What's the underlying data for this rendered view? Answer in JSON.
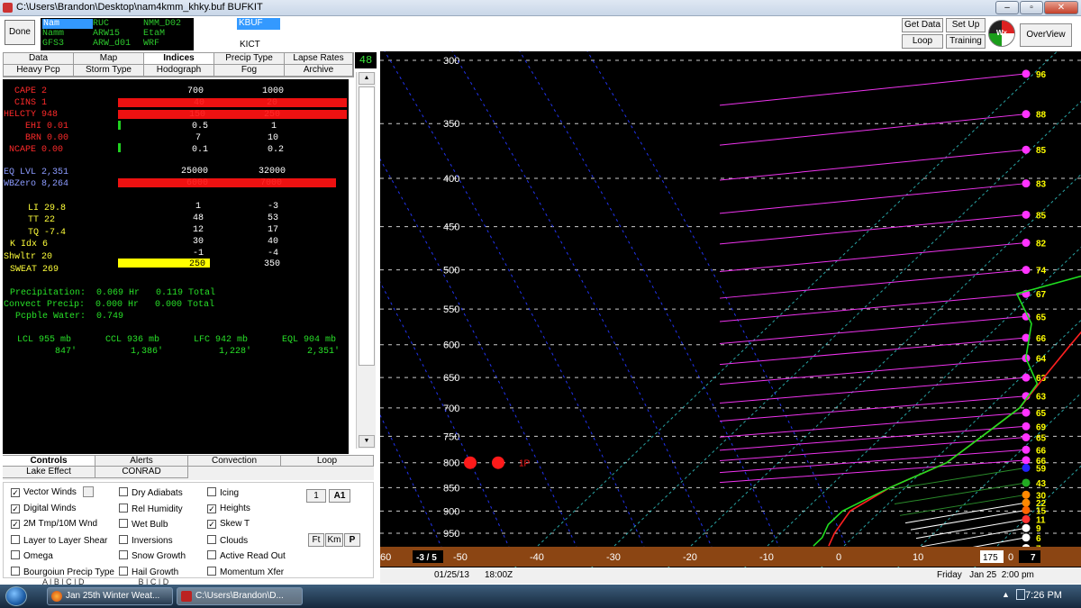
{
  "window": {
    "title": "C:\\Users\\Brandon\\Desktop\\nam4kmm_khky.buf BUFKIT",
    "min_label": "–",
    "max_label": "▫",
    "close_label": "✕"
  },
  "header": {
    "done_label": "Done",
    "models": [
      [
        "Nam",
        "RUC",
        "NMM_D02"
      ],
      [
        "Namm",
        "ARW15",
        "EtaM"
      ],
      [
        "GFS3",
        "ARW_d01",
        "WRF"
      ]
    ],
    "selected_station": "KBUF",
    "station_label": "KICT",
    "get_data": "Get Data",
    "setup": "Set Up",
    "loop": "Loop",
    "training": "Training",
    "overview": "OverView",
    "logo_text": "Wx"
  },
  "tabs_row1": [
    "Data",
    "Map",
    "Indices",
    "Precip Type",
    "Lapse Rates"
  ],
  "tabs_row2": [
    "Heavy Pcp",
    "Storm Type",
    "Hodograph",
    "Fog",
    "Archive"
  ],
  "hour_display": "48",
  "indices": {
    "cape": "CAPE 2",
    "cape_c1": "700",
    "cape_c2": "1000",
    "cins": "CINS 1",
    "cins_c1": "40",
    "cins_c2": "20",
    "helcty": "HELCTY 948",
    "helcty_c1": "150",
    "helcty_c2": "250",
    "ehi": "EHI 0.01",
    "ehi_c1": "0.5",
    "ehi_c2": "1",
    "brn": "BRN 0.00",
    "brn_c1": "7",
    "brn_c2": "10",
    "ncape": "NCAPE 0.00",
    "ncape_c1": "0.1",
    "ncape_c2": "0.2",
    "eqlvl": "EQ LVL 2,351",
    "eqlvl_c1": "25000",
    "eqlvl_c2": "32000",
    "wbzero": "WBZero 8,264",
    "wbzero_c1": "6000",
    "wbzero_c2": "7000",
    "li": "LI 29.8",
    "li_c1": "1",
    "li_c2": "-3",
    "tt": "TT 22",
    "tt_c1": "48",
    "tt_c2": "53",
    "tq": "TQ -7.4",
    "tq_c1": "12",
    "tq_c2": "17",
    "kidx": "K Idx 6",
    "kidx_c1": "30",
    "kidx_c2": "40",
    "shwltr": "Shwltr 20",
    "shwltr_c1": "-1",
    "shwltr_c2": "-4",
    "sweat": "SWEAT 269",
    "sweat_c1": "250",
    "sweat_c2": "350",
    "precip": "Precipitation:  0.069 Hr   0.119 Total",
    "convect": "Convect Precip:  0.000 Hr   0.000 Total",
    "pcpble": "Pcpble Water:  0.749",
    "lcl": "LCL 955 mb",
    "lcl_v": "847'",
    "ccl": "CCL 936 mb",
    "ccl_v": "1,386'",
    "lfc": "LFC 942 mb",
    "lfc_v": "1,228'",
    "eql": "EQL 904 mb",
    "eql_v": "2,351'"
  },
  "lower_tabs_row1": [
    "Controls",
    "Alerts",
    "Convection",
    "Loop"
  ],
  "lower_tabs_row2": [
    "Lake Effect",
    "CONRAD"
  ],
  "controls": {
    "col1": [
      {
        "label": "Vector Winds",
        "checked": true
      },
      {
        "label": "Digital Winds",
        "checked": true
      },
      {
        "label": "2M Tmp/10M Wnd",
        "checked": true
      },
      {
        "label": "Layer to Layer Shear",
        "checked": false
      },
      {
        "label": "Omega",
        "checked": false
      },
      {
        "label": "Bourgoiun Precip Type",
        "checked": false
      }
    ],
    "col2": [
      {
        "label": "Dry Adiabats",
        "checked": false
      },
      {
        "label": "Rel Humidity",
        "checked": false
      },
      {
        "label": "Wet Bulb",
        "checked": false
      },
      {
        "label": "Inversions",
        "checked": false
      },
      {
        "label": "Snow Growth",
        "checked": false
      },
      {
        "label": "Hail Growth",
        "checked": false
      }
    ],
    "col3": [
      {
        "label": "Icing",
        "checked": false
      },
      {
        "label": "Heights",
        "checked": true
      },
      {
        "label": "Skew T",
        "checked": true
      },
      {
        "label": "Clouds",
        "checked": false
      },
      {
        "label": "Active Read Out",
        "checked": false
      },
      {
        "label": "Momentum Xfer",
        "checked": false
      }
    ],
    "btn_1": "1",
    "btn_a1": "A1",
    "btn_ft": "Ft",
    "btn_km": "Km",
    "btn_p": "P",
    "bottom_row": "A | B | C | D                        B | C | D"
  },
  "chart_data": {
    "type": "line",
    "title": "",
    "pressure_levels": [
      300,
      350,
      400,
      450,
      500,
      550,
      600,
      650,
      700,
      750,
      800,
      850,
      900,
      950
    ],
    "pressure_labels": [
      "300",
      "350",
      "400",
      "450",
      "500",
      "550",
      "600",
      "650",
      "700",
      "750",
      "800",
      "850",
      "900",
      "950"
    ],
    "x_ticks": [
      -50,
      -40,
      -30,
      -20,
      -10,
      0,
      10
    ],
    "x_tick_labels": [
      "-50",
      "-40",
      "-30",
      "-20",
      "-10",
      "0",
      "10"
    ],
    "x_edge_label": "60",
    "series": [
      {
        "color": "#ff2020",
        "x": [
          [
            300,
            -5
          ],
          [
            350,
            -3
          ],
          [
            400,
            -2
          ],
          [
            450,
            -1
          ],
          [
            500,
            0
          ],
          [
            550,
            1
          ],
          [
            600,
            2
          ],
          [
            650,
            3
          ],
          [
            700,
            4
          ],
          [
            750,
            3
          ],
          [
            800,
            2
          ],
          [
            850,
            -2
          ],
          [
            900,
            -4
          ],
          [
            950,
            -3
          ],
          [
            980,
            -2
          ]
        ]
      },
      {
        "color": "#20e020",
        "x": [
          [
            300,
            -10
          ],
          [
            350,
            -9
          ],
          [
            400,
            -8
          ],
          [
            450,
            -6
          ],
          [
            500,
            -4
          ],
          [
            530,
            -12
          ],
          [
            570,
            -6
          ],
          [
            620,
            -2
          ],
          [
            660,
            3
          ],
          [
            700,
            4
          ],
          [
            750,
            3
          ],
          [
            800,
            2
          ],
          [
            850,
            -2
          ],
          [
            900,
            -5
          ],
          [
            930,
            -5
          ],
          [
            960,
            -4
          ],
          [
            980,
            -4
          ]
        ]
      }
    ],
    "wind_numbers": [
      "96",
      "88",
      "85",
      "83",
      "85",
      "82",
      "74",
      "67",
      "65",
      "66",
      "64",
      "63",
      "63",
      "65",
      "69",
      "65",
      "66",
      "66",
      "59",
      "43",
      "30",
      "22",
      "15",
      "11",
      "9",
      "6",
      "7"
    ],
    "wind_pressures": [
      310,
      342,
      373,
      405,
      437,
      468,
      500,
      530,
      560,
      590,
      620,
      650,
      680,
      708,
      732,
      752,
      775,
      795,
      810,
      840,
      865,
      882,
      898,
      918,
      938,
      960,
      985
    ],
    "marker_label": "1P",
    "sfc_box": "-3 / 5",
    "sfc_box2": "175",
    "sfc_box3": "7",
    "sfc_zero": "0"
  },
  "footer": {
    "date": "01/25/13",
    "time": "18:00Z",
    "valid": "Friday   Jan 25  2:00 pm"
  },
  "taskbar": {
    "task1": "Jan 25th Winter Weat...",
    "task2": "C:\\Users\\Brandon\\D...",
    "clock": "7:26 PM"
  }
}
